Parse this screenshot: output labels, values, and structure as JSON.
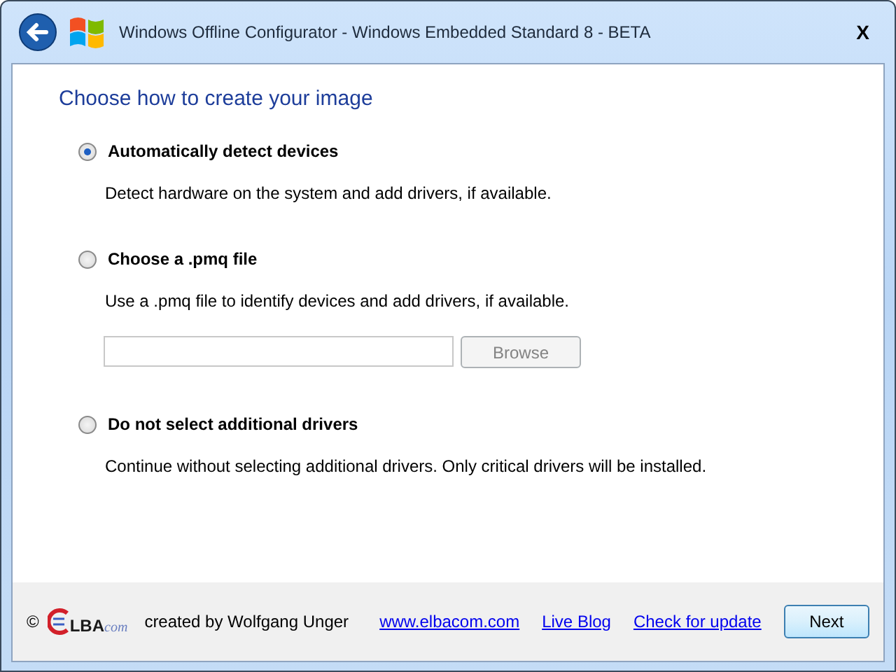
{
  "window": {
    "title": "Windows Offline Configurator - Windows Embedded Standard 8 - BETA",
    "close": "X"
  },
  "heading": "Choose how to create your image",
  "options": [
    {
      "label": "Automatically detect devices",
      "description": "Detect hardware on the system and add drivers, if available.",
      "selected": true
    },
    {
      "label": "Choose a .pmq file",
      "description": "Use a .pmq file to identify devices and add drivers, if available.",
      "selected": false,
      "file_field": {
        "button": "Browse",
        "disabled": true
      }
    },
    {
      "label": "Do not select additional drivers",
      "description": "Continue without selecting additional drivers. Only critical drivers will be installed.",
      "selected": false
    }
  ],
  "footer": {
    "copyright": "©",
    "logo": {
      "text": "LBA",
      "suffix": "com"
    },
    "credit": "created by Wolfgang Unger",
    "links": [
      "www.elbacom.com",
      "Live Blog",
      "Check for update"
    ],
    "next_button": "Next"
  }
}
